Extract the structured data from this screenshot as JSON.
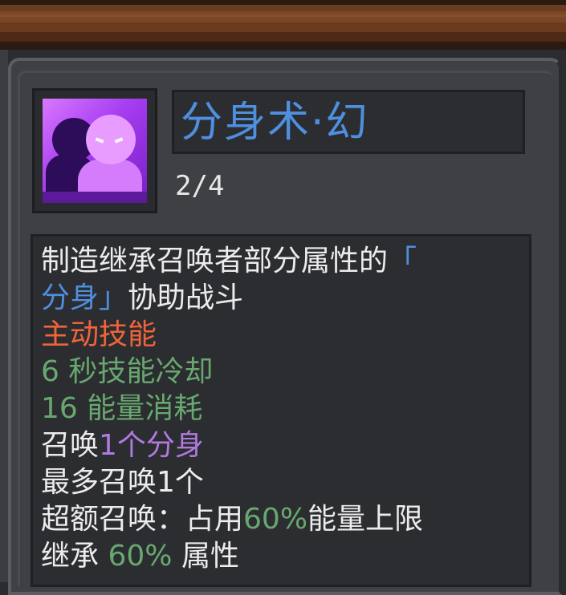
{
  "skill": {
    "icon": "twin-shadow-clone-icon",
    "title": "分身术·幻",
    "level": "2/4"
  },
  "description": {
    "line1_text": "制造继承召唤者部分属性的",
    "line1_bracket": "「",
    "line2_highlight": "分身」",
    "line2_text": "协助战斗",
    "skill_type": "主动技能",
    "cooldown": "6 秒技能冷却",
    "energy_cost": "16 能量消耗",
    "summon_prefix": "召唤",
    "summon_count": "1个",
    "summon_name": "分身",
    "max_summon": "最多召唤1个",
    "overflow_prefix": "超额召唤：占用",
    "overflow_value": "60%",
    "overflow_suffix": "能量上限",
    "inherit_prefix": "继承",
    "inherit_value": "60%",
    "inherit_suffix": "属性"
  },
  "colors": {
    "highlight_blue": "#4f8fe0",
    "skill_type_orange": "#f0643c",
    "stat_green": "#68a870",
    "summon_purple": "#b07ae0",
    "text_white": "#ececec"
  }
}
